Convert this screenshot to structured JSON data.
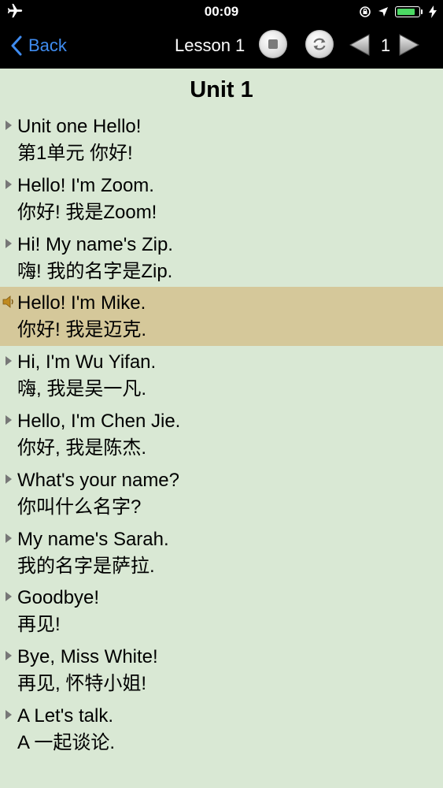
{
  "status_bar": {
    "time": "00:09",
    "battery_color": "#4cd964",
    "battery_level": 0.85,
    "left_icon": "airplane-icon",
    "right_icons": [
      "orientation-lock-icon",
      "location-arrow-icon",
      "battery-icon",
      "charging-bolt-icon"
    ]
  },
  "nav": {
    "back_label": "Back",
    "lesson_label": "Lesson 1",
    "page_number": "1",
    "back_color": "#3f8cf0",
    "controls": [
      "stop-icon",
      "refresh-icon",
      "previous-triangle-icon",
      "next-triangle-icon"
    ]
  },
  "content": {
    "title": "Unit 1",
    "active_index": 3,
    "highlight_color": "#d5c89a",
    "background_color": "#d9e8d4",
    "lines": [
      {
        "en": "Unit one Hello!",
        "zh": "第1单元 你好!"
      },
      {
        "en": "Hello! I'm Zoom.",
        "zh": "你好! 我是Zoom!"
      },
      {
        "en": "Hi! My name's Zip.",
        "zh": "嗨! 我的名字是Zip."
      },
      {
        "en": "Hello! I'm Mike.",
        "zh": "你好! 我是迈克."
      },
      {
        "en": "Hi, I'm Wu Yifan.",
        "zh": "嗨, 我是吴一凡."
      },
      {
        "en": "Hello, I'm Chen Jie.",
        "zh": "你好, 我是陈杰."
      },
      {
        "en": "What's your name?",
        "zh": "你叫什么名字?"
      },
      {
        "en": "My name's Sarah.",
        "zh": "我的名字是萨拉."
      },
      {
        "en": "Goodbye!",
        "zh": "再见!"
      },
      {
        "en": "Bye, Miss White!",
        "zh": "再见, 怀特小姐!"
      },
      {
        "en": "A Let's talk.",
        "zh": "A 一起谈论."
      }
    ]
  }
}
